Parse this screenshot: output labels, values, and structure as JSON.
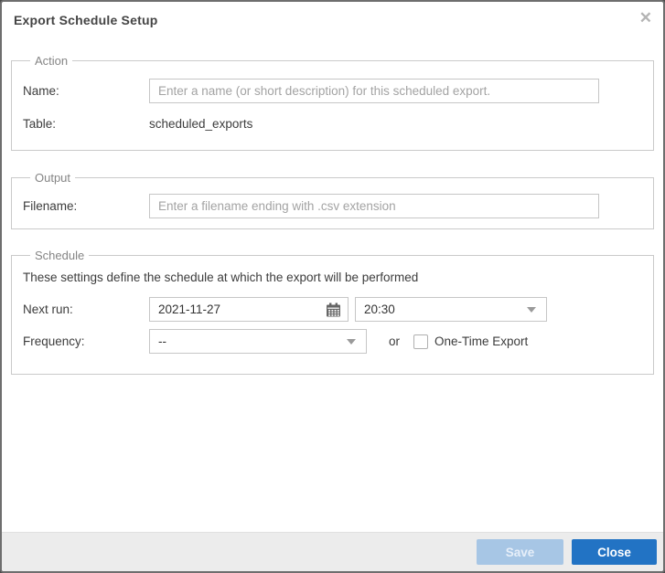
{
  "dialog": {
    "title": "Export Schedule Setup",
    "close_glyph": "✕"
  },
  "action": {
    "legend": "Action",
    "name_label": "Name:",
    "name_placeholder": "Enter a name (or short description) for this scheduled export.",
    "name_value": "",
    "table_label": "Table:",
    "table_value": "scheduled_exports"
  },
  "output": {
    "legend": "Output",
    "filename_label": "Filename:",
    "filename_placeholder": "Enter a filename ending with .csv extension",
    "filename_value": ""
  },
  "schedule": {
    "legend": "Schedule",
    "description": "These settings define the schedule at which the export will be performed",
    "next_run_label": "Next run:",
    "date_value": "2021-11-27",
    "time_value": "20:30",
    "frequency_label": "Frequency:",
    "frequency_value": "--",
    "or_label": "or",
    "one_time_label": "One-Time Export",
    "one_time_checked": false
  },
  "footer": {
    "save_label": "Save",
    "save_enabled": false,
    "close_label": "Close"
  },
  "icons": {
    "close": "x-icon",
    "calendar": "calendar-icon",
    "dropdown": "chevron-down-icon"
  },
  "colors": {
    "close_button_bg": "#2273c4",
    "save_button_disabled_bg": "#a7c6e5",
    "footer_bg": "#ececec",
    "dialog_border": "#6e6e6e",
    "fieldset_border": "#cacaca",
    "label_text": "#3c3c3c",
    "placeholder_text": "#a3a3a3"
  }
}
